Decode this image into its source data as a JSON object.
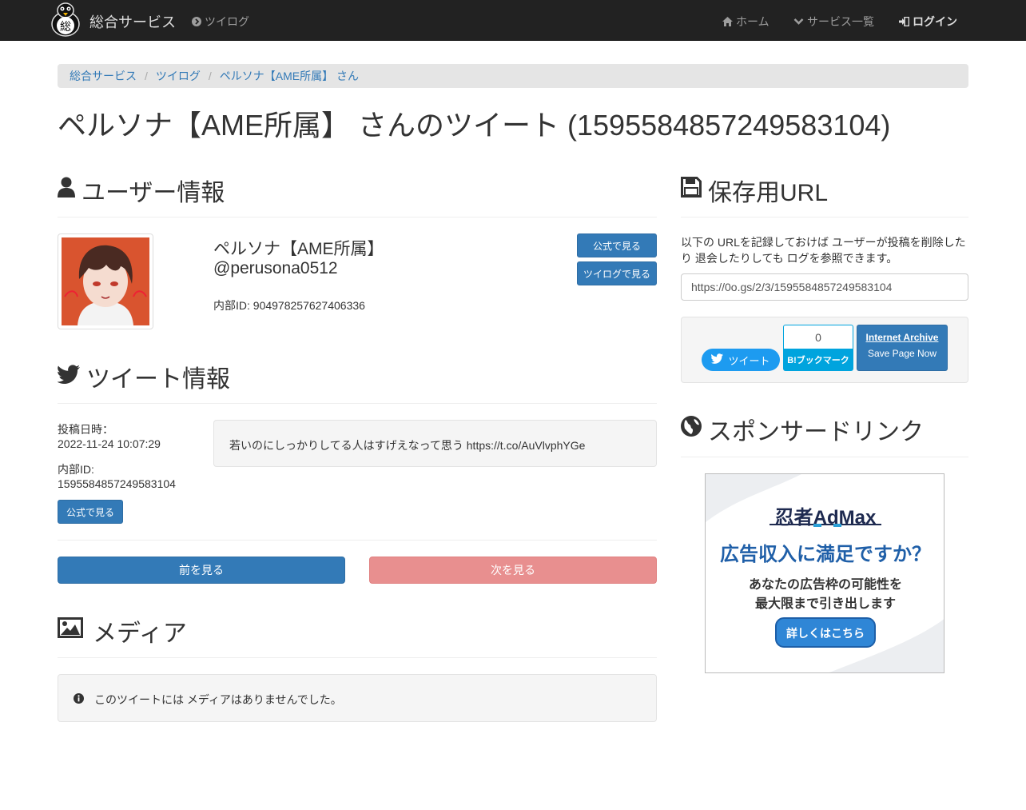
{
  "navbar": {
    "brand": "総合サービス",
    "twilog_link": "ツイログ",
    "home_link": "ホーム",
    "services_link": "サービス一覧",
    "login_link": "ログイン",
    "logo_char": "総"
  },
  "breadcrumb": {
    "items": [
      "総合サービス",
      "ツイログ",
      "ペルソナ【AME所属】 さん"
    ]
  },
  "page_title": "ペルソナ【AME所属】 さんのツイート (1595584857249583104)",
  "user_info": {
    "heading": "ユーザー情報",
    "name": "ペルソナ【AME所属】",
    "screen_name": "@perusona0512",
    "internal_id": "内部ID: 904978257627406336",
    "official_button": "公式で見る",
    "twilog_button": "ツイログで見る"
  },
  "tweet_info": {
    "heading": "ツイート情報",
    "posted_label": "投稿日時：",
    "posted_value": "2022-11-24 10:07:29",
    "id_label": "内部ID:",
    "id_value": "1595584857249583104",
    "official_button": "公式で見る",
    "text": "若いのにしっかりしてる人はすげえなって思う https://t.co/AuVlvphYGe"
  },
  "pager": {
    "prev": "前を見る",
    "next": "次を見る"
  },
  "media": {
    "heading": "メディア",
    "empty_message": "このツイートには メディアはありませんでした。"
  },
  "save_url": {
    "heading": "保存用URL",
    "description": "以下の URLを記録しておけば ユーザーが投稿を削除したり 退会したりしても ログを参照できます。",
    "url": "https://0o.gs/2/3/1595584857249583104"
  },
  "share": {
    "tweet_button": "ツイート",
    "hatena_count": "0",
    "hatena_button": "B!ブックマーク",
    "ia_title": "Internet Archive",
    "ia_sub": "Save Page Now"
  },
  "sponsor": {
    "heading": "スポンサードリンク",
    "ad_brand": "忍者AdMax",
    "ad_headline": "広告収入に満足ですか？",
    "ad_line1": "あなたの広告枠の可能性を",
    "ad_line2": "最大限まで引き出します",
    "ad_button": "詳しくはこちら"
  },
  "colors": {
    "navbar": "#222222",
    "primary": "#337ab7",
    "danger_disabled": "#e88f8f",
    "twitter": "#1d9bf0",
    "hatena": "#00a4de"
  }
}
